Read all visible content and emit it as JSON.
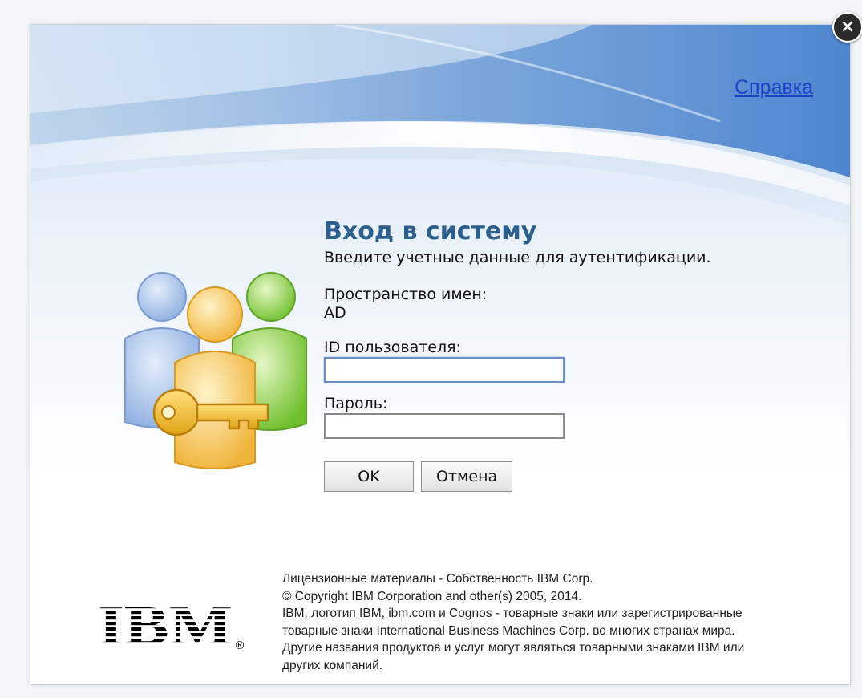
{
  "dialog": {
    "close_symbol": "×",
    "help_link": "Справка",
    "title": "Вход в систему",
    "subtitle": "Введите учетные данные для аутентификации.",
    "namespace": {
      "label": "Пространство имен:",
      "value": "AD"
    },
    "user_id": {
      "label": "ID пользователя:",
      "value": ""
    },
    "password": {
      "label": "Пароль:",
      "value": ""
    },
    "buttons": {
      "ok": "OK",
      "cancel": "Отмена"
    },
    "copyright": {
      "line1": "Лицензионные материалы - Собственность IBM Corp.",
      "line2": "© Copyright IBM Corporation and other(s) 2005, 2014.",
      "line3": "IBM, логотип IBM, ibm.com и Cognos - товарные знаки или зарегистрированные",
      "line4": "товарные знаки International Business Machines Corp. во многих странах мира.",
      "line5": "Другие названия продуктов и услуг могут являться товарными знаками IBM или",
      "line6": "других компаний."
    },
    "logo": {
      "text": "IBM",
      "registered": "®"
    }
  },
  "icons": {
    "close": "close-icon",
    "users": "users-key-icon",
    "logo": "ibm-logo"
  },
  "colors": {
    "title": "#2d5f8e",
    "link": "#1f43c8",
    "banner_blue": "#5a8fd0"
  }
}
